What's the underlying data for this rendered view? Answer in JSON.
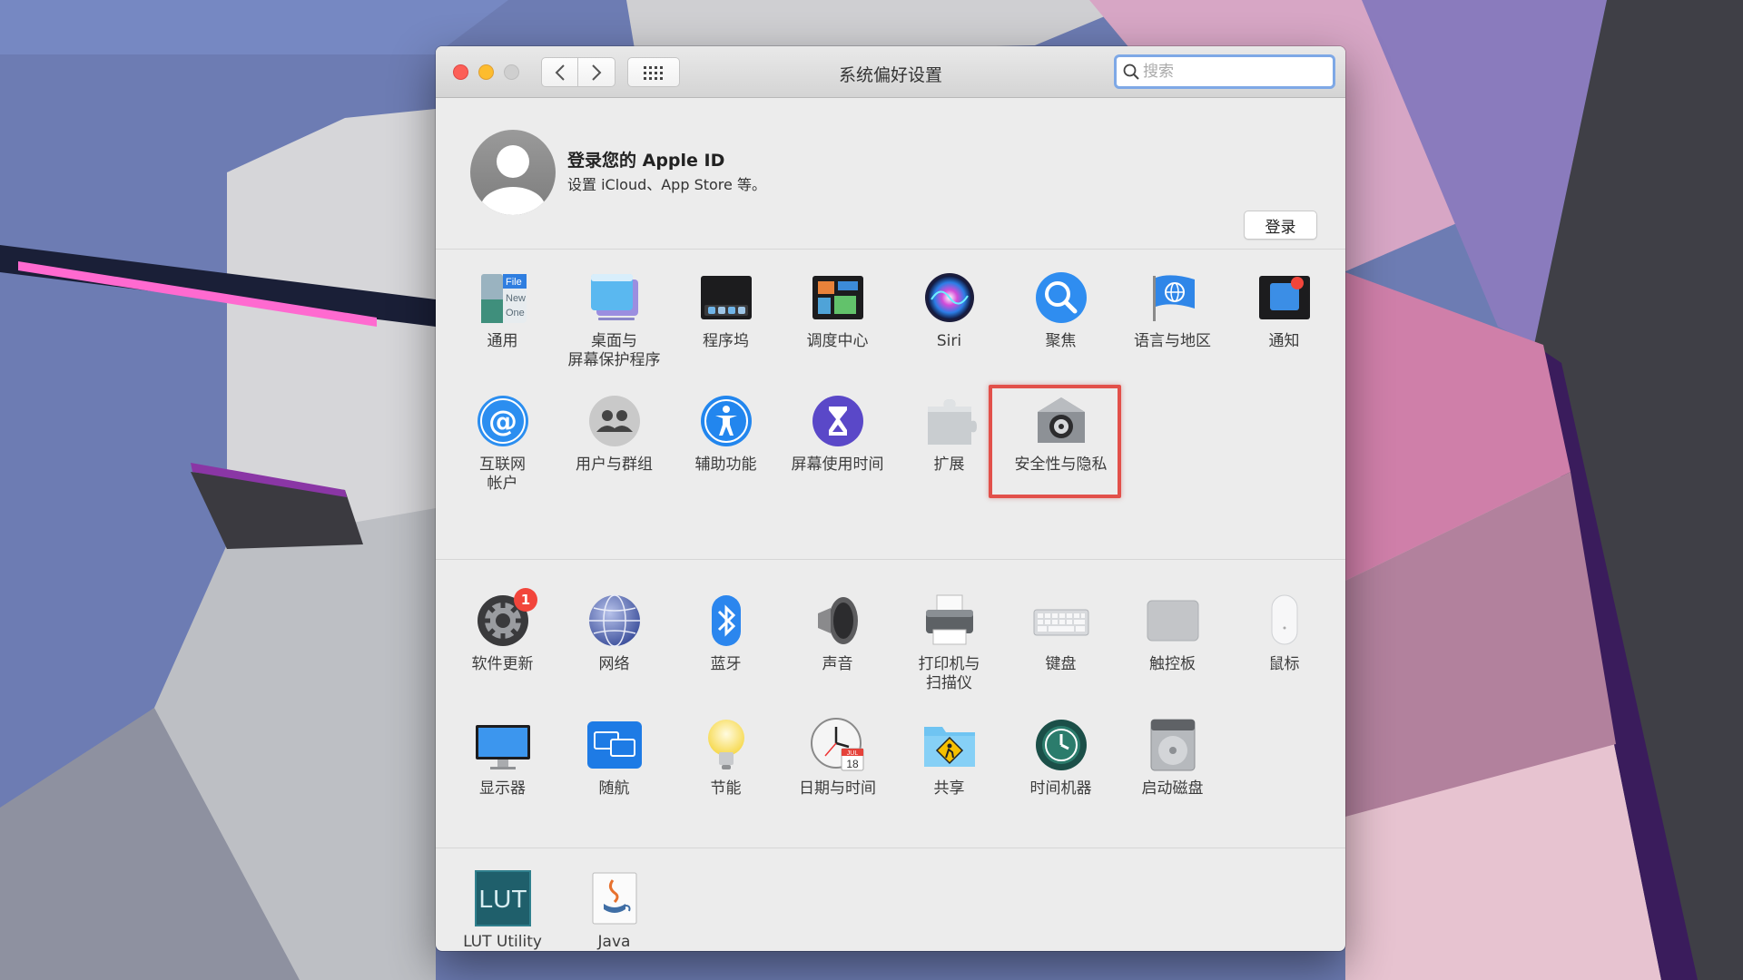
{
  "window": {
    "title": "系统偏好设置",
    "search_placeholder": "搜索"
  },
  "account": {
    "title": "登录您的 Apple ID",
    "subtitle": "设置 iCloud、App Store 等。",
    "login_label": "登录"
  },
  "row1": [
    {
      "label": "通用",
      "icon": "general-icon"
    },
    {
      "label": "桌面与\n屏幕保护程序",
      "icon": "desktop-screensaver-icon"
    },
    {
      "label": "程序坞",
      "icon": "dock-icon"
    },
    {
      "label": "调度中心",
      "icon": "mission-control-icon"
    },
    {
      "label": "Siri",
      "icon": "siri-icon"
    },
    {
      "label": "聚焦",
      "icon": "spotlight-icon"
    },
    {
      "label": "语言与地区",
      "icon": "language-region-icon"
    },
    {
      "label": "通知",
      "icon": "notifications-icon"
    }
  ],
  "row2": [
    {
      "label": "互联网\n帐户",
      "icon": "internet-accounts-icon"
    },
    {
      "label": "用户与群组",
      "icon": "users-groups-icon"
    },
    {
      "label": "辅助功能",
      "icon": "accessibility-icon"
    },
    {
      "label": "屏幕使用时间",
      "icon": "screen-time-icon"
    },
    {
      "label": "扩展",
      "icon": "extensions-icon"
    },
    {
      "label": "安全性与隐私",
      "icon": "security-privacy-icon"
    }
  ],
  "row3": [
    {
      "label": "软件更新",
      "icon": "software-update-icon",
      "badge": "1"
    },
    {
      "label": "网络",
      "icon": "network-icon"
    },
    {
      "label": "蓝牙",
      "icon": "bluetooth-icon"
    },
    {
      "label": "声音",
      "icon": "sound-icon"
    },
    {
      "label": "打印机与\n扫描仪",
      "icon": "printers-scanners-icon"
    },
    {
      "label": "键盘",
      "icon": "keyboard-icon"
    },
    {
      "label": "触控板",
      "icon": "trackpad-icon"
    },
    {
      "label": "鼠标",
      "icon": "mouse-icon"
    }
  ],
  "row4": [
    {
      "label": "显示器",
      "icon": "displays-icon"
    },
    {
      "label": "随航",
      "icon": "sidecar-icon"
    },
    {
      "label": "节能",
      "icon": "energy-saver-icon"
    },
    {
      "label": "日期与时间",
      "icon": "date-time-icon"
    },
    {
      "label": "共享",
      "icon": "sharing-icon"
    },
    {
      "label": "时间机器",
      "icon": "time-machine-icon"
    },
    {
      "label": "启动磁盘",
      "icon": "startup-disk-icon"
    }
  ],
  "row5": [
    {
      "label": "LUT Utility",
      "icon": "lut-utility-icon"
    },
    {
      "label": "Java",
      "icon": "java-icon"
    }
  ],
  "icon_text": {
    "general_file": "File",
    "general_new": "New",
    "general_one": "One",
    "lut": "LUT",
    "calendar_month": "JUL",
    "calendar_day": "18"
  },
  "colors": {
    "accent_blue": "#2f80ed",
    "highlight_red": "#e2504a",
    "badge_red": "#f2453b"
  }
}
